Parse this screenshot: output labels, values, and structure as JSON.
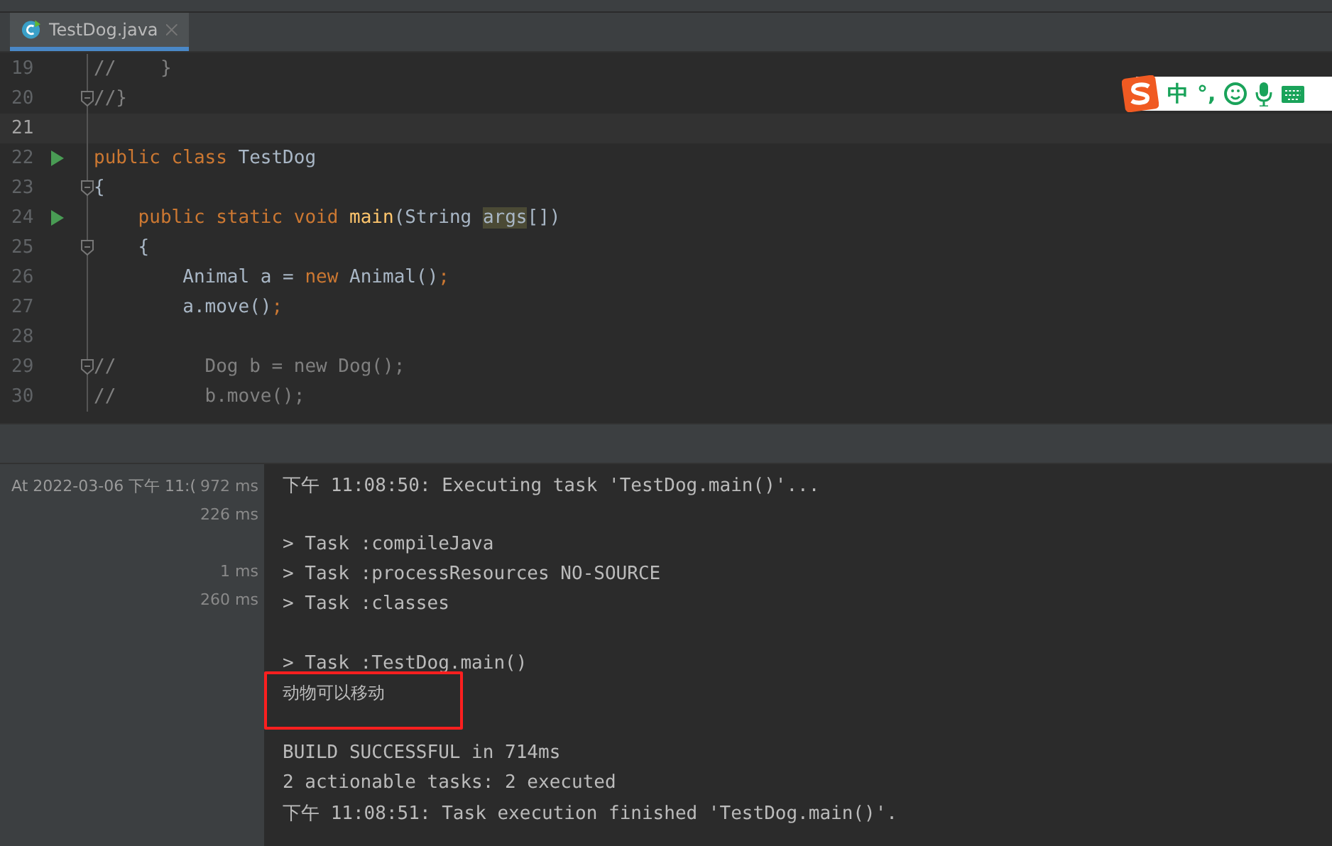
{
  "tabs": [
    {
      "label": "TestDog.java",
      "selected": true
    }
  ],
  "editor": {
    "lines": [
      {
        "number": "19",
        "run": false,
        "foldable": false,
        "current": false,
        "tokens": [
          {
            "text": "//    }",
            "kind": "comment"
          }
        ]
      },
      {
        "number": "20",
        "run": false,
        "foldable": true,
        "current": false,
        "tokens": [
          {
            "text": "//}",
            "kind": "comment"
          }
        ]
      },
      {
        "number": "21",
        "run": false,
        "foldable": false,
        "current": true
      },
      {
        "number": "22",
        "run": true,
        "foldable": false,
        "current": false,
        "tokens": [
          {
            "text": "public class ",
            "kind": "keyword"
          },
          {
            "text": "TestDog",
            "kind": "plain"
          }
        ]
      },
      {
        "number": "23",
        "run": false,
        "foldable": true,
        "current": false,
        "tokens": [
          {
            "text": "{",
            "kind": "plain"
          }
        ]
      },
      {
        "number": "24",
        "run": true,
        "foldable": false,
        "current": false,
        "tokens": [
          {
            "text": "    public static void ",
            "kind": "keyword"
          },
          {
            "text": "main",
            "kind": "method"
          },
          {
            "text": "(String ",
            "kind": "plain"
          },
          {
            "text": "args",
            "kind": "highlight"
          },
          {
            "text": "[])",
            "kind": "plain"
          }
        ]
      },
      {
        "number": "25",
        "run": false,
        "foldable": true,
        "current": false,
        "tokens": [
          {
            "text": "    {",
            "kind": "plain"
          }
        ]
      },
      {
        "number": "26",
        "run": false,
        "foldable": false,
        "current": false,
        "tokens": [
          {
            "text": "        Animal a = ",
            "kind": "plain"
          },
          {
            "text": "new ",
            "kind": "keyword"
          },
          {
            "text": "Animal()",
            "kind": "plain"
          },
          {
            "text": ";",
            "kind": "keyword"
          }
        ]
      },
      {
        "number": "27",
        "run": false,
        "foldable": false,
        "current": false,
        "tokens": [
          {
            "text": "        a.move()",
            "kind": "plain"
          },
          {
            "text": ";",
            "kind": "keyword"
          }
        ]
      },
      {
        "number": "28",
        "run": false,
        "foldable": false,
        "current": false
      },
      {
        "number": "29",
        "run": false,
        "foldable": true,
        "current": false,
        "tokens": [
          {
            "text": "//        Dog b = new Dog();",
            "kind": "comment"
          }
        ]
      },
      {
        "number": "30",
        "run": false,
        "foldable": false,
        "current": false,
        "tokens": [
          {
            "text": "//        b.move();",
            "kind": "comment"
          }
        ]
      }
    ]
  },
  "ime_toolbar": {
    "mode": "中",
    "punctuation": "°,"
  },
  "run_tree": [
    {
      "label": "At 2022-03-06 下午 11:(",
      "duration": "972 ms"
    },
    {
      "duration": "226 ms"
    },
    {
      "duration": "1 ms",
      "gap_before": true
    },
    {
      "duration": "260 ms"
    }
  ],
  "console": {
    "lines": [
      {
        "text": "下午 11:08:50: Executing task 'TestDog.main()'...",
        "marked": false
      },
      {
        "text": "> Task :compileJava",
        "marked": false,
        "gap_before": true
      },
      {
        "text": "> Task :processResources NO-SOURCE",
        "marked": false
      },
      {
        "text": "> Task :classes",
        "marked": false
      },
      {
        "text": "> Task :TestDog.main()",
        "marked": false,
        "gap_before": true
      },
      {
        "text": "动物可以移动",
        "marked": true
      },
      {
        "text": "BUILD SUCCESSFUL in 714ms",
        "marked": false,
        "gap_before": true
      },
      {
        "text": "2 actionable tasks: 2 executed",
        "marked": false
      },
      {
        "text": "下午 11:08:51: Task execution finished 'TestDog.main()'.",
        "marked": false
      }
    ]
  }
}
